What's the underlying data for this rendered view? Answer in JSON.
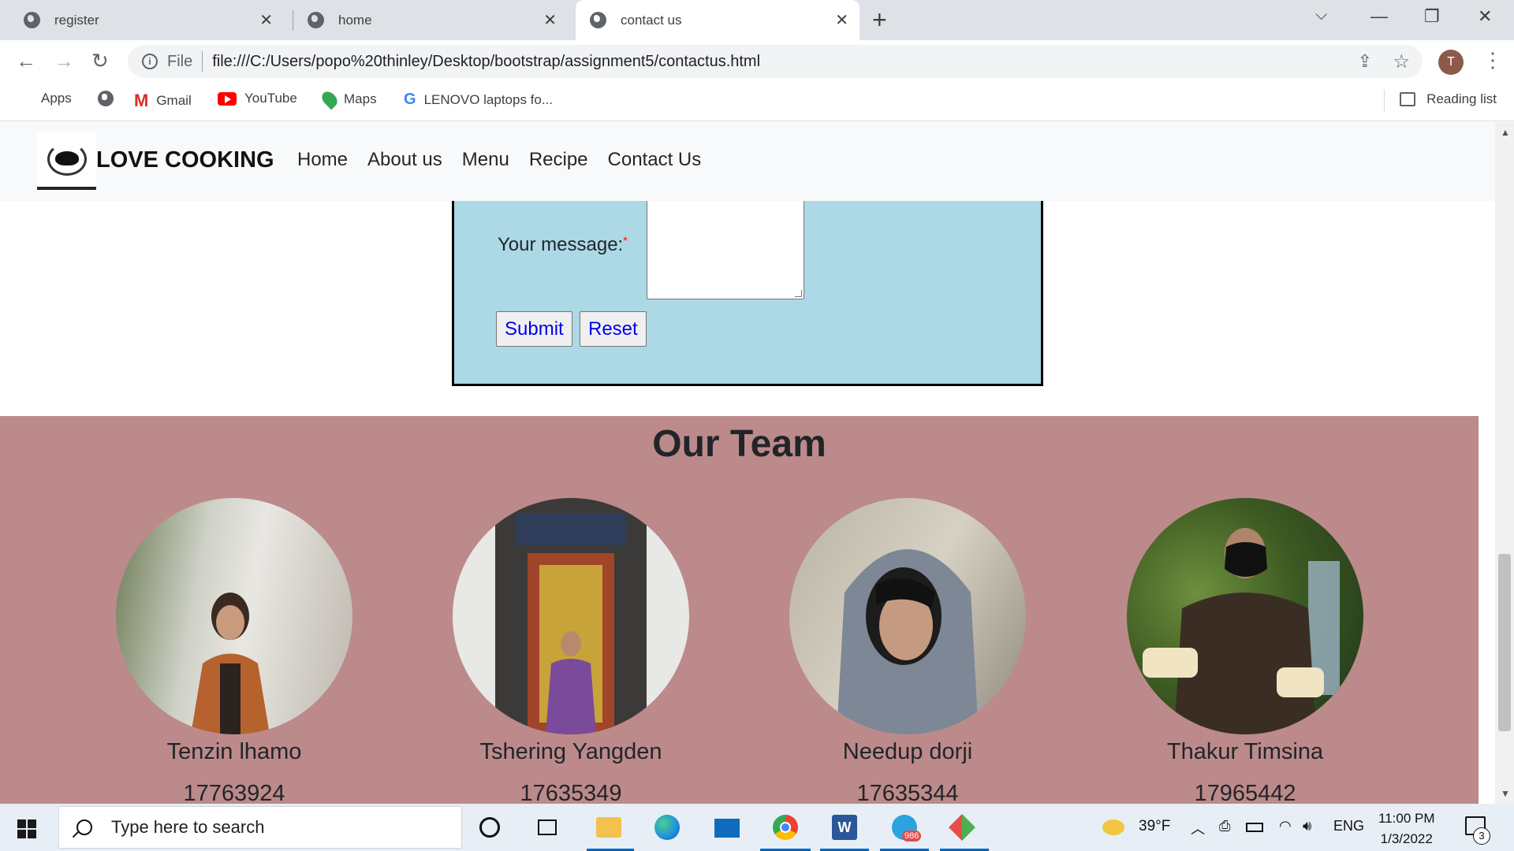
{
  "browser": {
    "tabs": [
      {
        "title": "register"
      },
      {
        "title": "home"
      },
      {
        "title": "contact us"
      }
    ],
    "address": {
      "scheme_label": "File",
      "url": "file:///C:/Users/popo%20thinley/Desktop/bootstrap/assignment5/contactus.html"
    },
    "profile_initial": "T",
    "bookmarks": [
      "Apps",
      "Gmail",
      "YouTube",
      "Maps",
      "LENOVO laptops fo..."
    ],
    "reading_list": "Reading list"
  },
  "site": {
    "brand": "LOVE COOKING",
    "nav": [
      "Home",
      "About us",
      "Menu",
      "Recipe",
      "Contact Us"
    ],
    "form": {
      "message_label": "Your message:",
      "required_mark": "*",
      "submit": "Submit",
      "reset": "Reset"
    },
    "team": {
      "heading": "Our Team",
      "members": [
        {
          "name": "Tenzin lhamo",
          "phone": "17763924"
        },
        {
          "name": "Tshering Yangden",
          "phone": "17635349"
        },
        {
          "name": "Needup dorji",
          "phone": "17635344"
        },
        {
          "name": "Thakur Timsina",
          "phone": "17965442"
        }
      ]
    }
  },
  "taskbar": {
    "search_placeholder": "Type here to search",
    "weather": "39°F",
    "language": "ENG",
    "time": "11:00 PM",
    "date": "1/3/2022",
    "telegram_badge": "986",
    "notification_count": "3"
  }
}
